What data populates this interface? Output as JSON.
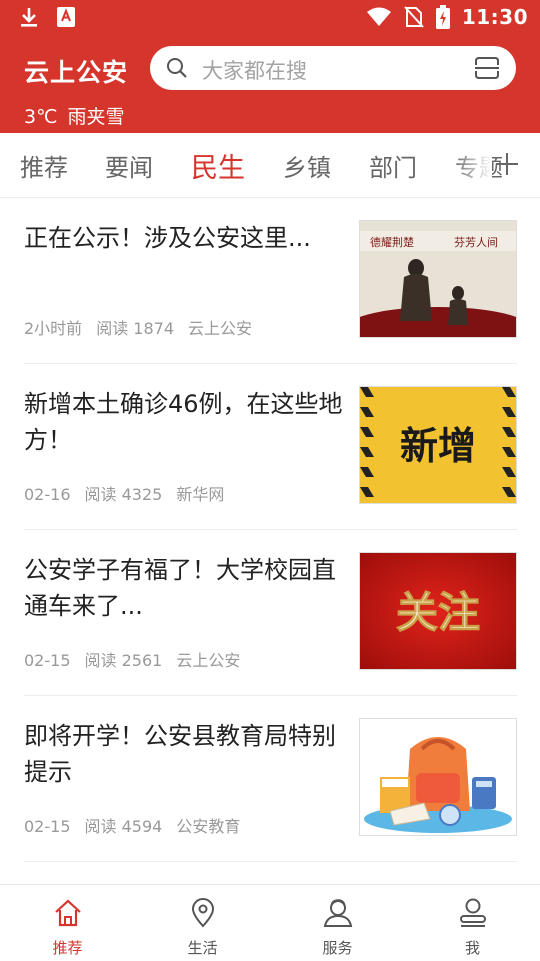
{
  "status_bar": {
    "time": "11:30",
    "icons": [
      "download-icon",
      "app-notification-icon",
      "wifi-icon",
      "no-sim-icon",
      "battery-charging-icon"
    ]
  },
  "header": {
    "app_title": "云上公安",
    "search_placeholder": "大家都在搜",
    "weather_temp": "3℃",
    "weather_desc": "雨夹雪",
    "accent_color": "#d6352c"
  },
  "tabs": [
    {
      "label": "推荐"
    },
    {
      "label": "要闻"
    },
    {
      "label": "民生",
      "active": true
    },
    {
      "label": "乡镇"
    },
    {
      "label": "部门"
    },
    {
      "label": "专题"
    }
  ],
  "articles": [
    {
      "title": "正在公示！涉及公安这里...",
      "time": "2小时前",
      "reads": "阅读 1874",
      "source": "云上公安",
      "thumb_caption_left": "德耀荆楚",
      "thumb_caption_right": "芬芳人间"
    },
    {
      "title": "新增本土确诊46例，在这些地方！",
      "time": "02-16",
      "reads": "阅读 4325",
      "source": "新华网",
      "thumb_text": "新增"
    },
    {
      "title": "公安学子有福了！大学校园直通车来了...",
      "time": "02-15",
      "reads": "阅读 2561",
      "source": "云上公安",
      "thumb_text": "关注"
    },
    {
      "title": "即将开学！公安县教育局特别提示",
      "time": "02-15",
      "reads": "阅读 4594",
      "source": "公安教育"
    }
  ],
  "bottom_nav": [
    {
      "label": "推荐",
      "icon": "home-icon",
      "active": true
    },
    {
      "label": "生活",
      "icon": "location-pin-icon"
    },
    {
      "label": "服务",
      "icon": "service-person-icon"
    },
    {
      "label": "我",
      "icon": "profile-icon"
    }
  ]
}
